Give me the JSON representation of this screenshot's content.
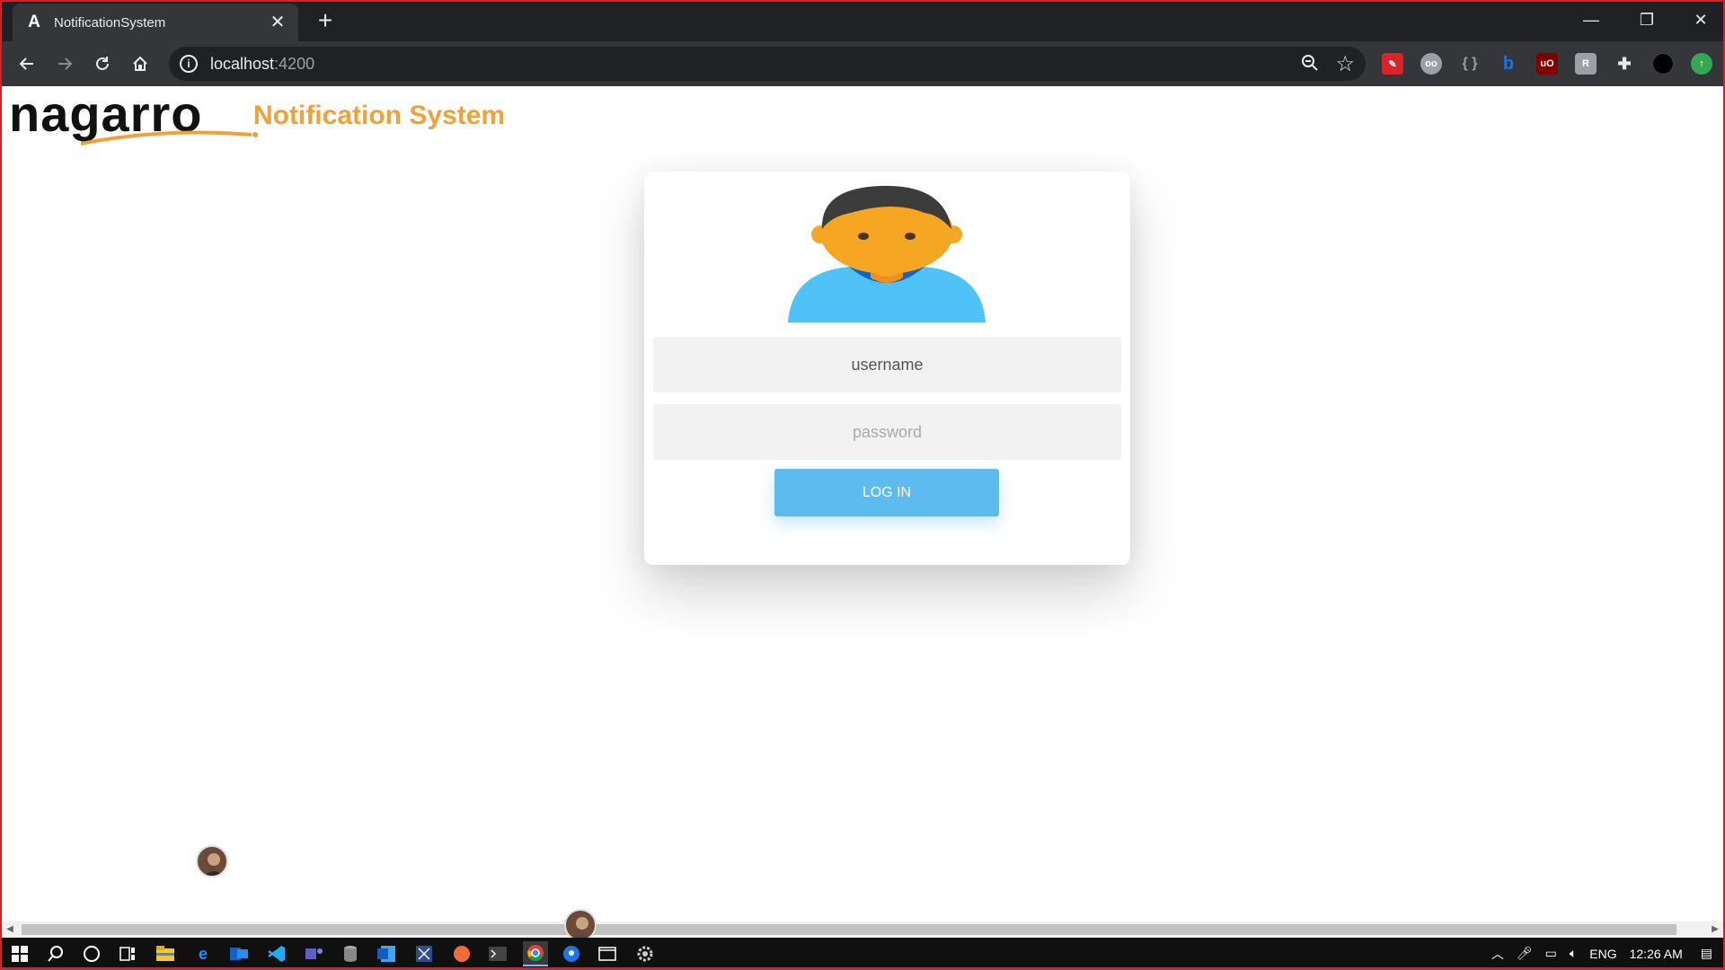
{
  "browser": {
    "tab_title": "NotificationSystem",
    "tab_favicon_letter": "A",
    "tab_close": "✕",
    "new_tab": "+",
    "url_host": "localhost",
    "url_port": ":4200",
    "window_controls": [
      "—",
      "❐",
      "✕"
    ]
  },
  "page": {
    "logo_text": "nagarro",
    "app_title": "Notification System",
    "login": {
      "username_placeholder": "username",
      "password_placeholder": "password",
      "button_label": "LOG IN"
    }
  },
  "taskbar": {
    "language": "ENG",
    "time": "12:26 AM"
  },
  "colors": {
    "accent_orange": "#f0a13a",
    "button_blue": "#5dbbef",
    "frame_red": "#d81e2a"
  },
  "icons": [
    "back-icon",
    "forward-icon",
    "reload-icon",
    "home-icon",
    "info-icon",
    "zoom-icon",
    "star-icon",
    "extensions-icon",
    "windows-start-icon",
    "search-icon",
    "cortana-icon",
    "task-view-icon"
  ]
}
